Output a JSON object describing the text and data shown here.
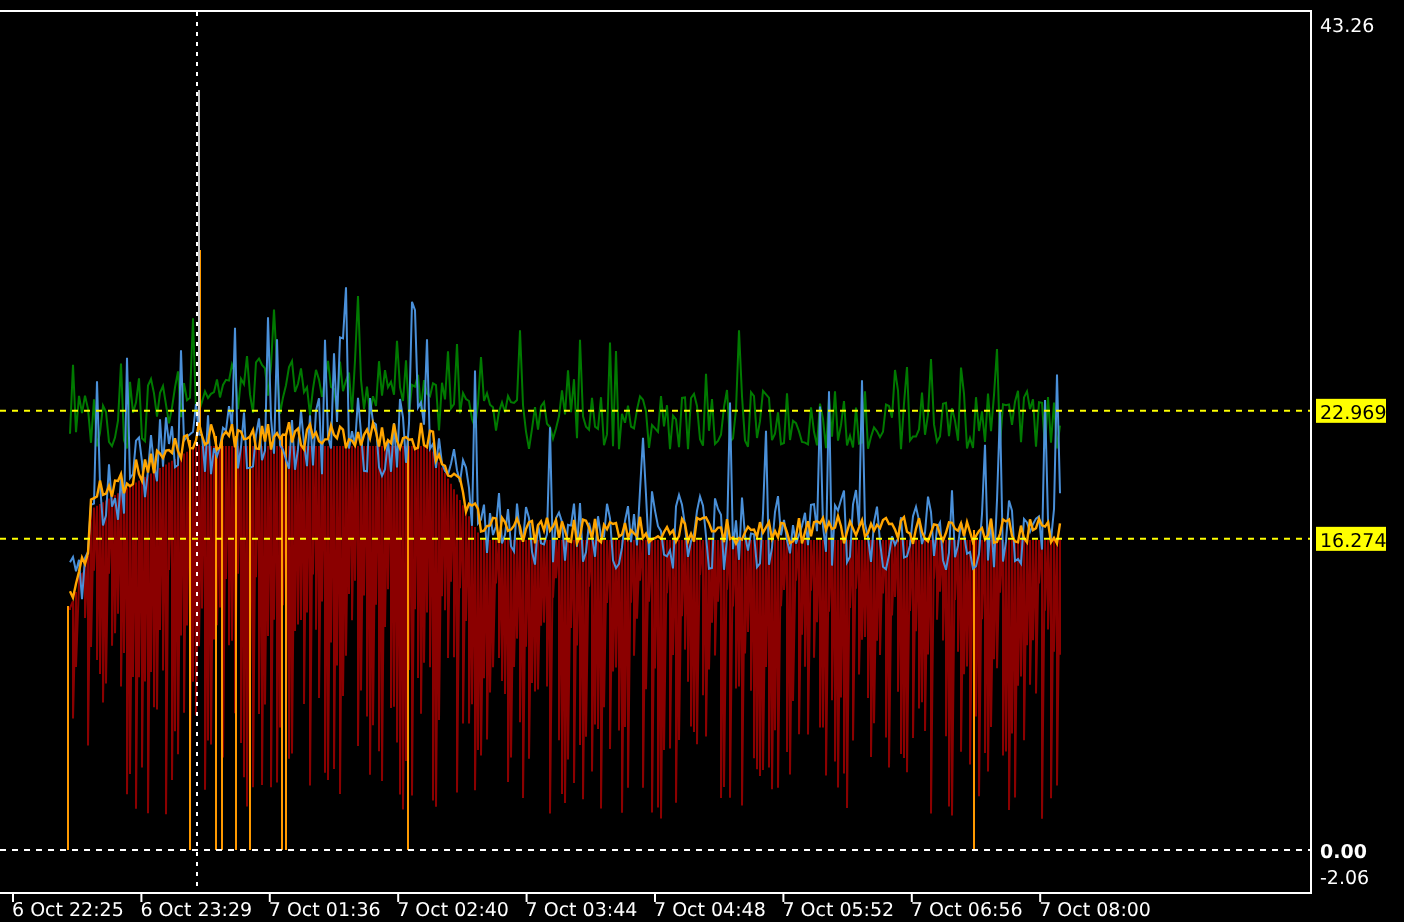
{
  "price_axis": {
    "labels": [
      "43.26",
      "-2.06"
    ]
  },
  "levels": [
    {
      "label": "22.969",
      "kind": "highlight"
    },
    {
      "label": "16.274",
      "kind": "highlight"
    },
    {
      "label": "0.00",
      "kind": "zero"
    }
  ],
  "time_axis": {
    "labels": [
      "6 Oct 22:25",
      "6 Oct 23:29",
      "7 Oct 01:36",
      "7 Oct 02:40",
      "7 Oct 03:44",
      "7 Oct 04:48",
      "7 Oct 05:52",
      "7 Oct 06:56",
      "7 Oct 08:00"
    ]
  }
}
